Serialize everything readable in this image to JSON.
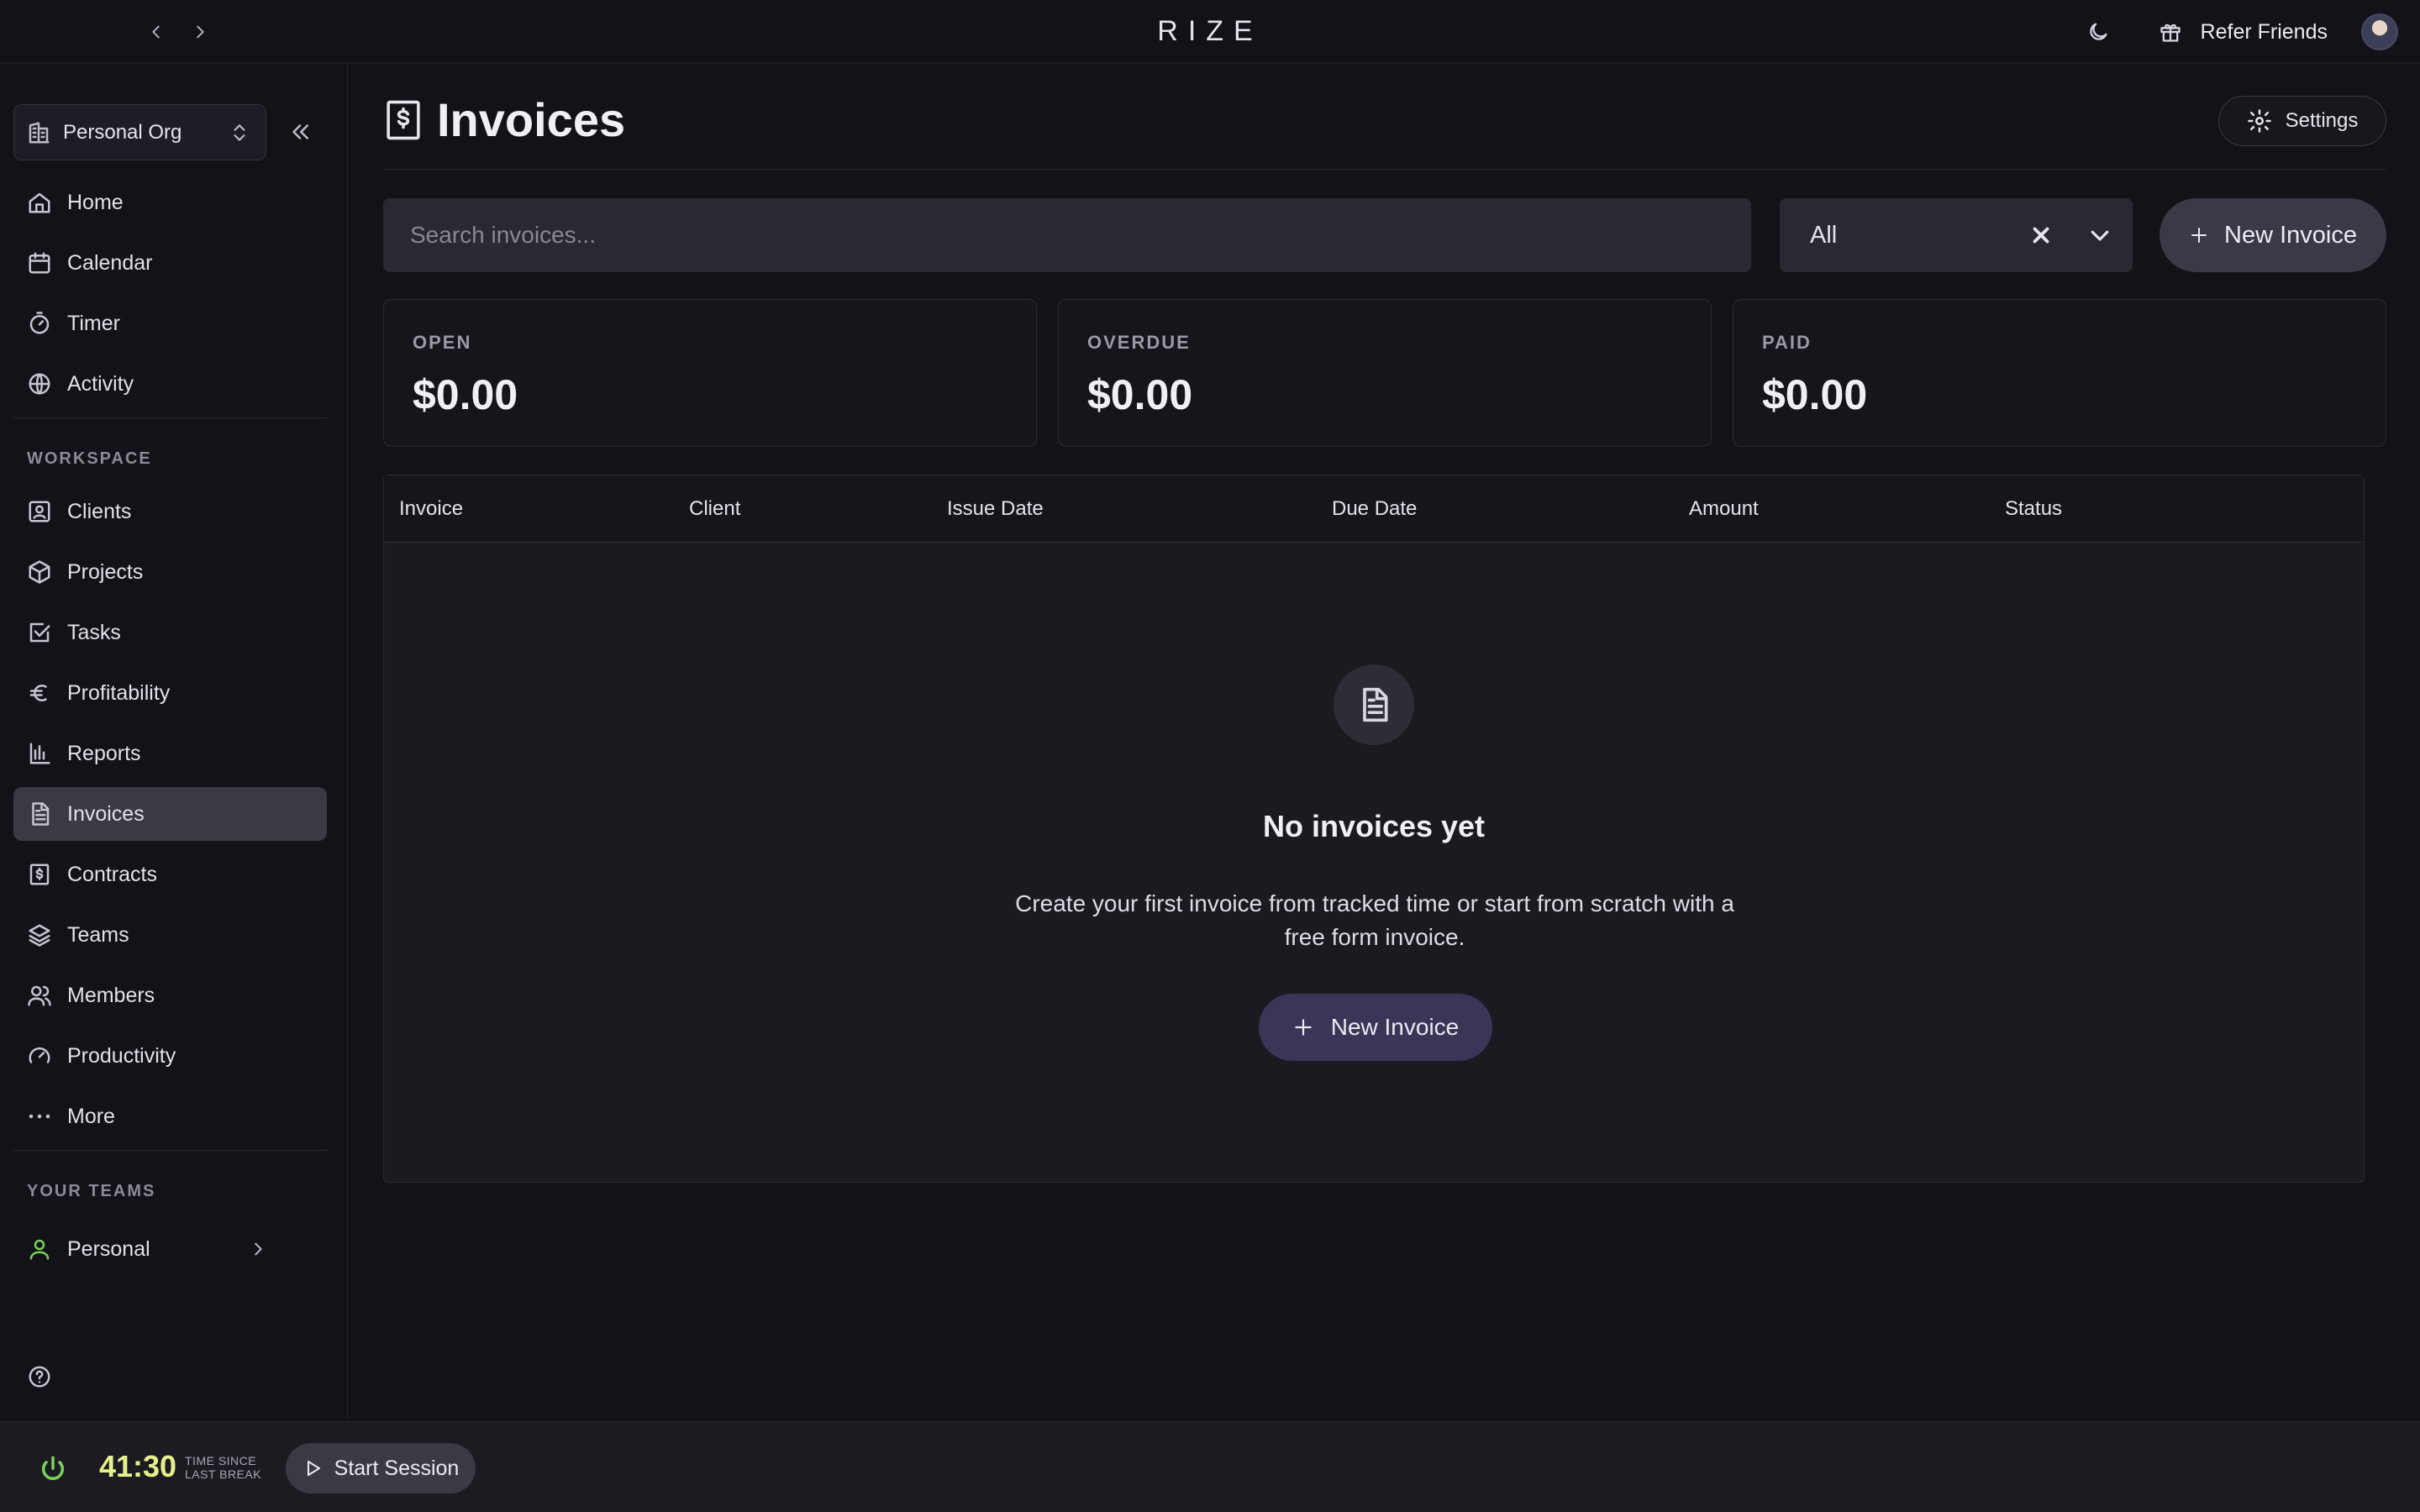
{
  "app": {
    "brand": "RIZE",
    "refer_label": "Refer Friends"
  },
  "sidebar": {
    "org_label": "Personal Org",
    "items_main": [
      {
        "label": "Home",
        "icon": "home-icon"
      },
      {
        "label": "Calendar",
        "icon": "calendar-icon"
      },
      {
        "label": "Timer",
        "icon": "timer-icon"
      },
      {
        "label": "Activity",
        "icon": "globe-icon"
      }
    ],
    "workspace_label": "WORKSPACE",
    "items_workspace": [
      {
        "label": "Clients",
        "icon": "client-icon"
      },
      {
        "label": "Projects",
        "icon": "cube-icon"
      },
      {
        "label": "Tasks",
        "icon": "checkbox-icon"
      },
      {
        "label": "Profitability",
        "icon": "euro-icon"
      },
      {
        "label": "Reports",
        "icon": "bar-chart-icon"
      },
      {
        "label": "Invoices",
        "icon": "document-icon"
      },
      {
        "label": "Contracts",
        "icon": "contract-icon"
      },
      {
        "label": "Teams",
        "icon": "layers-icon"
      },
      {
        "label": "Members",
        "icon": "users-icon"
      },
      {
        "label": "Productivity",
        "icon": "gauge-icon"
      },
      {
        "label": "More",
        "icon": "more-icon"
      }
    ],
    "active_item": "Invoices",
    "teams_label": "YOUR TEAMS",
    "team_item": "Personal"
  },
  "main": {
    "title": "Invoices",
    "settings_label": "Settings",
    "search_placeholder": "Search invoices...",
    "filter_value": "All",
    "new_invoice_label": "New Invoice",
    "stats": [
      {
        "label": "OPEN",
        "value": "$0.00"
      },
      {
        "label": "OVERDUE",
        "value": "$0.00"
      },
      {
        "label": "PAID",
        "value": "$0.00"
      }
    ],
    "table_headers": [
      "Invoice",
      "Client",
      "Issue Date",
      "Due Date",
      "Amount",
      "Status"
    ],
    "empty_title": "No invoices yet",
    "empty_desc": "Create your first invoice from tracked time or start from scratch with a free form invoice.",
    "empty_button": "New Invoice"
  },
  "footer": {
    "timer_value": "41:30",
    "timer_label_1": "TIME SINCE",
    "timer_label_2": "LAST BREAK",
    "start_label": "Start Session"
  },
  "colors": {
    "background": "#131219",
    "active_item": "#3a3944",
    "timer_accent": "#e6f08a",
    "power_green": "#7ad15a",
    "empty_button": "#3b3657"
  }
}
